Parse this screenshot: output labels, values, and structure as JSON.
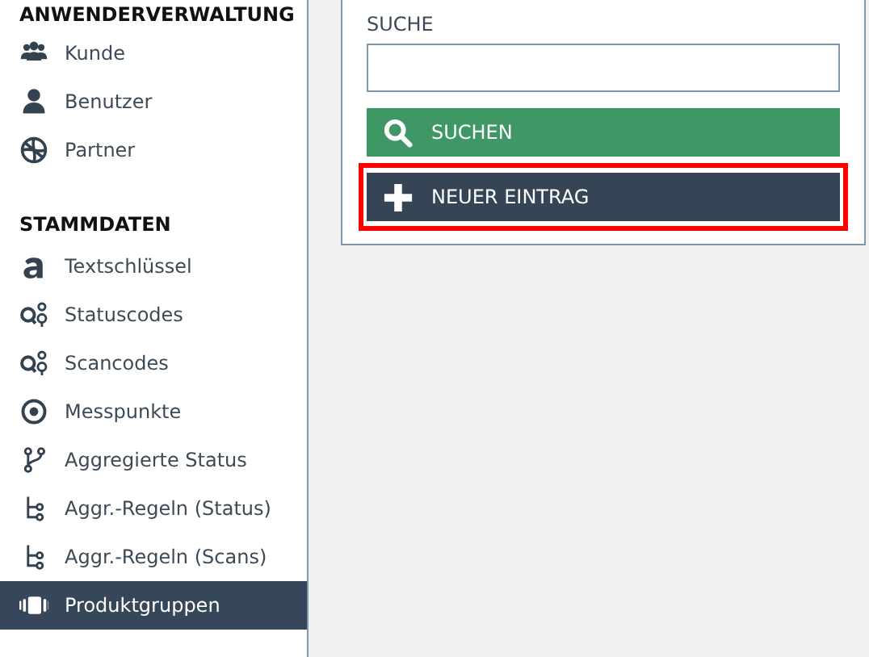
{
  "sidebar": {
    "sections": [
      {
        "heading": "ANWENDERVERWALTUNG",
        "items": [
          {
            "label": "Kunde",
            "kind": "users",
            "selected": false
          },
          {
            "label": "Benutzer",
            "kind": "user",
            "selected": false
          },
          {
            "label": "Partner",
            "kind": "globe",
            "selected": false
          }
        ]
      },
      {
        "heading": "STAMMDATEN",
        "items": [
          {
            "label": "Textschlüssel",
            "kind": "letter",
            "selected": false
          },
          {
            "label": "Statuscodes",
            "kind": "nodes",
            "selected": false
          },
          {
            "label": "Scancodes",
            "kind": "nodes",
            "selected": false
          },
          {
            "label": "Messpunkte",
            "kind": "target",
            "selected": false
          },
          {
            "label": "Aggregierte Status",
            "kind": "branch",
            "selected": false
          },
          {
            "label": "Aggr.-Regeln (Status)",
            "kind": "tree",
            "selected": false
          },
          {
            "label": "Aggr.-Regeln (Scans)",
            "kind": "tree",
            "selected": false
          },
          {
            "label": "Produktgruppen",
            "kind": "capsule",
            "selected": true
          }
        ]
      }
    ]
  },
  "search_panel": {
    "label": "SUCHE",
    "buttons": [
      {
        "label": "SUCHEN",
        "kind": "search",
        "highlighted": false
      },
      {
        "label": "NEUER EINTRAG",
        "kind": "add",
        "highlighted": true
      }
    ]
  }
}
